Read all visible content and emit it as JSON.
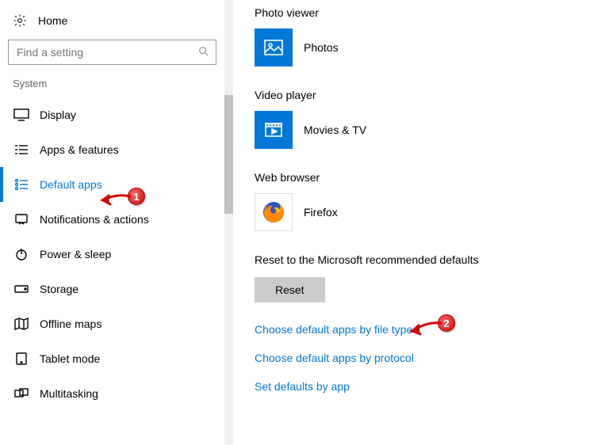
{
  "sidebar": {
    "home_label": "Home",
    "search_placeholder": "Find a setting",
    "category_label": "System",
    "items": [
      {
        "icon": "display",
        "label": "Display"
      },
      {
        "icon": "apps",
        "label": "Apps & features"
      },
      {
        "icon": "default-apps",
        "label": "Default apps",
        "selected": true
      },
      {
        "icon": "notifications",
        "label": "Notifications & actions"
      },
      {
        "icon": "power",
        "label": "Power & sleep"
      },
      {
        "icon": "storage",
        "label": "Storage"
      },
      {
        "icon": "offline-maps",
        "label": "Offline maps"
      },
      {
        "icon": "tablet",
        "label": "Tablet mode"
      },
      {
        "icon": "multitasking",
        "label": "Multitasking"
      }
    ]
  },
  "content": {
    "sections": {
      "photo_viewer": {
        "heading": "Photo viewer",
        "app_name": "Photos"
      },
      "video_player": {
        "heading": "Video player",
        "app_name": "Movies & TV"
      },
      "web_browser": {
        "heading": "Web browser",
        "app_name": "Firefox"
      }
    },
    "reset_text": "Reset to the Microsoft recommended defaults",
    "reset_button": "Reset",
    "links": {
      "by_file_type": "Choose default apps by file type",
      "by_protocol": "Choose default apps by protocol",
      "by_app": "Set defaults by app"
    }
  },
  "annotations": {
    "marker1": "1",
    "marker2": "2"
  }
}
